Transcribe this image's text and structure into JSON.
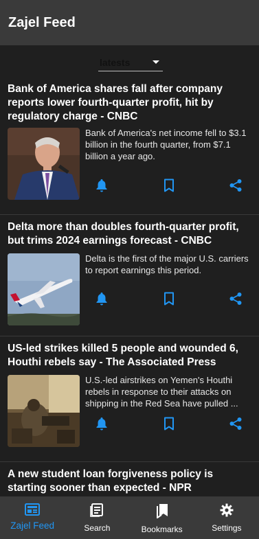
{
  "appbar": {
    "title": "Zajel Feed"
  },
  "filter": {
    "selected": "latests"
  },
  "colors": {
    "accent": "#2196f3",
    "appbar": "#3a3a3a",
    "background": "#1e1e1e"
  },
  "articles": [
    {
      "title": "Bank of America shares fall after company reports lower fourth-quarter profit, hit by regulatory charge - CNBC",
      "summary": "Bank of America's net income fell to $3.1 billion in the fourth quarter, from $7.1 billion a year ago.",
      "actions": [
        "bell-icon",
        "bookmark-icon",
        "share-icon"
      ]
    },
    {
      "title": "Delta more than doubles fourth-quarter profit, but trims 2024 earnings forecast - CNBC",
      "summary": "Delta is the first of the major U.S. carriers to report earnings this period.",
      "actions": [
        "bell-icon",
        "bookmark-icon",
        "share-icon"
      ]
    },
    {
      "title": "US-led strikes killed 5 people and wounded 6, Houthi rebels say - The Associated Press",
      "summary": "U.S.-led airstrikes on Yemen's Houthi rebels in response to their attacks on shipping in the Red Sea have pulled ...",
      "actions": [
        "bell-icon",
        "bookmark-icon",
        "share-icon"
      ]
    },
    {
      "title": "A new student loan forgiveness policy is starting sooner than expected - NPR"
    }
  ],
  "nav": [
    {
      "label": "Zajel Feed",
      "icon": "feed-icon",
      "active": true
    },
    {
      "label": "Search",
      "icon": "article-icon",
      "active": false
    },
    {
      "label": "Bookmarks",
      "icon": "bookmarks-icon",
      "active": false
    },
    {
      "label": "Settings",
      "icon": "gear-icon",
      "active": false
    }
  ]
}
